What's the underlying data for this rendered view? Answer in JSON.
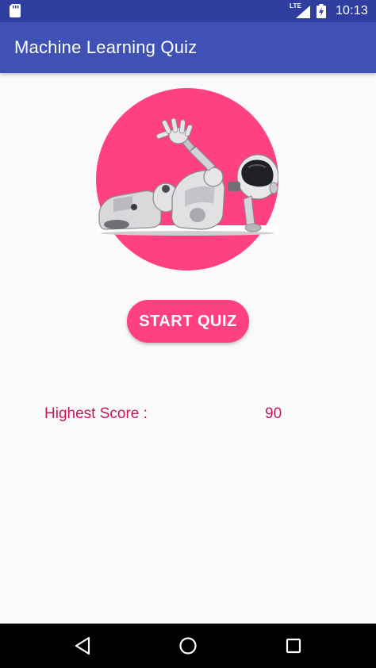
{
  "status_bar": {
    "left_icon": "sd-card-icon",
    "network_label": "LTE",
    "signal_icon": "signal-icon",
    "battery_icon": "battery-charging-icon",
    "time": "10:13"
  },
  "app_bar": {
    "title": "Machine Learning Quiz"
  },
  "hero": {
    "image": "robot-on-pink-circle",
    "circle_color": "#ff4081"
  },
  "main": {
    "start_button_label": "START QUIZ",
    "highest_score_label": "Highest Score :",
    "highest_score_value": "90"
  },
  "nav_bar": {
    "back_icon": "back-triangle-icon",
    "home_icon": "home-circle-icon",
    "recents_icon": "recents-square-icon"
  },
  "colors": {
    "status_bar": "#303f9f",
    "app_bar": "#3f51b5",
    "accent": "#ff4081",
    "score_text": "#c2185b",
    "background": "#fafafa",
    "nav_bar": "#000000"
  }
}
